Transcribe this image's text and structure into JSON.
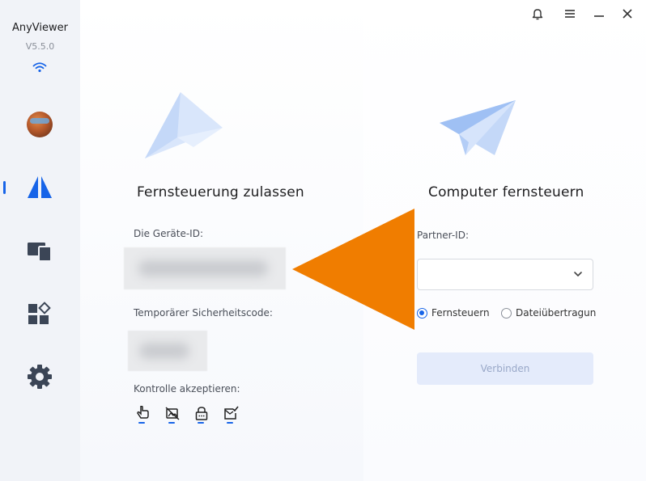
{
  "app": {
    "name": "AnyViewer",
    "version": "V5.5.0"
  },
  "sidebar": {
    "items": [
      {
        "name": "profile",
        "icon": "avatar"
      },
      {
        "name": "remote-control",
        "icon": "anyviewer-logo-icon",
        "active": true
      },
      {
        "name": "devices",
        "icon": "devices-icon"
      },
      {
        "name": "apps",
        "icon": "apps-icon"
      },
      {
        "name": "settings",
        "icon": "gear-icon"
      }
    ]
  },
  "titlebar": {
    "icons": [
      "bell-icon",
      "menu-icon",
      "minimize-icon",
      "close-icon"
    ]
  },
  "allow_panel": {
    "title": "Fernsteuerung zulassen",
    "device_id_label": "Die Geräte-ID:",
    "temp_code_label": "Temporärer Sicherheitscode:",
    "accept_control_label": "Kontrolle akzeptieren:",
    "control_icons": [
      "mouse-hand-icon",
      "no-image-icon",
      "lock-icon",
      "checked-mail-icon"
    ]
  },
  "control_panel": {
    "title": "Computer fernsteuern",
    "partner_id_label": "Partner-ID:",
    "partner_id_value": "",
    "radio_options": [
      {
        "label": "Fernsteuern",
        "checked": true
      },
      {
        "label": "Dateiübertragun",
        "checked": false
      }
    ],
    "connect_label": "Verbinden"
  },
  "colors": {
    "accent": "#1764e8",
    "overlay_arrow": "#f07d00",
    "sidebar_bg": "#f1f3f8"
  }
}
